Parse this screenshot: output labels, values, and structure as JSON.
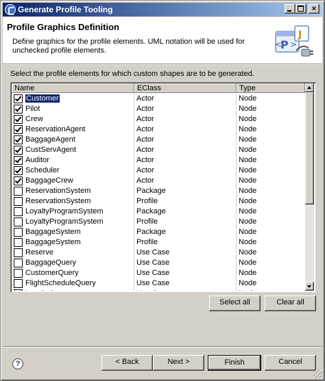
{
  "window": {
    "title": "Generate Profile Tooling",
    "minimize": "_",
    "maximize": "□",
    "close": "×"
  },
  "header": {
    "title": "Profile Graphics Definition",
    "description": "Define graphics for the profile elements.  UML notation will be used for unchecked profile elements.",
    "banner_icon": "profile-plugin-icon"
  },
  "instruction": "Select the profile elements for which custom shapes are to be generated.",
  "table": {
    "columns": [
      "Name",
      "EClass",
      "Type"
    ],
    "rows": [
      {
        "name": "Customer",
        "eclass": "Actor",
        "type": "Node",
        "checked": true,
        "selected": true
      },
      {
        "name": "Pilot",
        "eclass": "Actor",
        "type": "Node",
        "checked": true
      },
      {
        "name": "Crew",
        "eclass": "Actor",
        "type": "Node",
        "checked": true
      },
      {
        "name": "ReservationAgent",
        "eclass": "Actor",
        "type": "Node",
        "checked": true
      },
      {
        "name": "BaggageAgent",
        "eclass": "Actor",
        "type": "Node",
        "checked": true
      },
      {
        "name": "CustServAgent",
        "eclass": "Actor",
        "type": "Node",
        "checked": true
      },
      {
        "name": "Auditor",
        "eclass": "Actor",
        "type": "Node",
        "checked": true
      },
      {
        "name": "Scheduler",
        "eclass": "Actor",
        "type": "Node",
        "checked": true
      },
      {
        "name": "BaggageCrew",
        "eclass": "Actor",
        "type": "Node",
        "checked": true
      },
      {
        "name": "ReservationSystem",
        "eclass": "Package",
        "type": "Node",
        "checked": false
      },
      {
        "name": "ReservationSystem",
        "eclass": "Profile",
        "type": "Node",
        "checked": false
      },
      {
        "name": "LoyaltyProgramSystem",
        "eclass": "Package",
        "type": "Node",
        "checked": false
      },
      {
        "name": "LoyaltyProgramSystem",
        "eclass": "Profile",
        "type": "Node",
        "checked": false
      },
      {
        "name": "BaggageSystem",
        "eclass": "Package",
        "type": "Node",
        "checked": false
      },
      {
        "name": "BaggageSystem",
        "eclass": "Profile",
        "type": "Node",
        "checked": false
      },
      {
        "name": "Reserve",
        "eclass": "Use Case",
        "type": "Node",
        "checked": false
      },
      {
        "name": "BaggageQuery",
        "eclass": "Use Case",
        "type": "Node",
        "checked": false
      },
      {
        "name": "CustomerQuery",
        "eclass": "Use Case",
        "type": "Node",
        "checked": false
      },
      {
        "name": "FlightScheduleQuery",
        "eclass": "Use Case",
        "type": "Node",
        "checked": false
      },
      {
        "name": "LoyaltyQuery",
        "eclass": "Use Case",
        "type": "Node",
        "checked": false
      }
    ]
  },
  "buttons": {
    "select_all": "Select all",
    "clear_all": "Clear all",
    "back": "< Back",
    "next": "Next >",
    "finish": "Finish",
    "cancel": "Cancel",
    "help": "?"
  },
  "colors": {
    "title_gradient_start": "#0a246a",
    "title_gradient_end": "#a6caf0",
    "selection": "#0a246a",
    "dialog_face": "#d4d0c8"
  }
}
